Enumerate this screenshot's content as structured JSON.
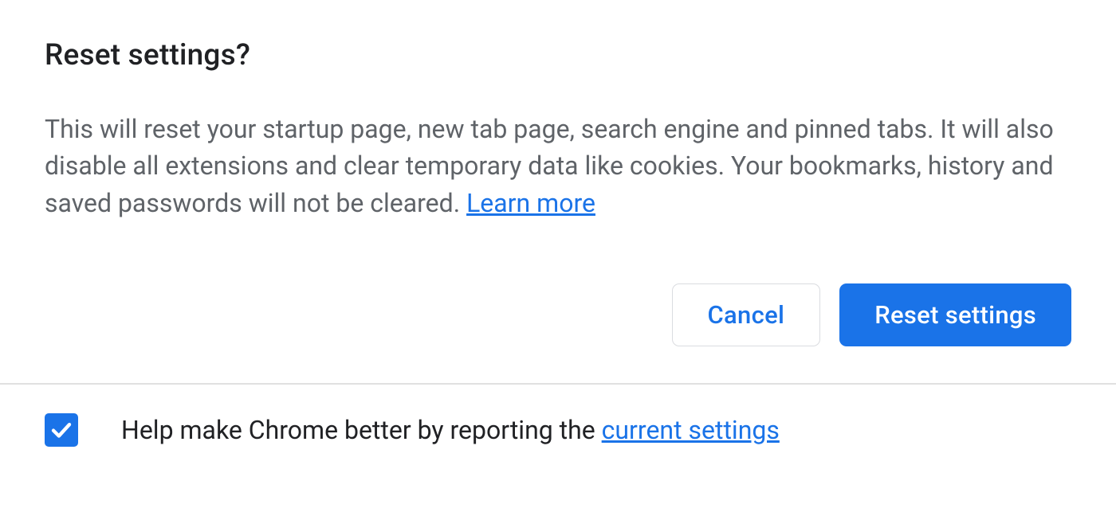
{
  "dialog": {
    "title": "Reset settings?",
    "body_text": "This will reset your startup page, new tab page, search engine and pinned tabs. It will also disable all extensions and clear temporary data like cookies. Your bookmarks, history and saved passwords will not be cleared. ",
    "learn_more_label": "Learn more"
  },
  "actions": {
    "cancel_label": "Cancel",
    "confirm_label": "Reset settings"
  },
  "footer": {
    "checkbox_checked": true,
    "help_text_prefix": "Help make Chrome better by reporting the ",
    "help_link_label": "current settings"
  }
}
